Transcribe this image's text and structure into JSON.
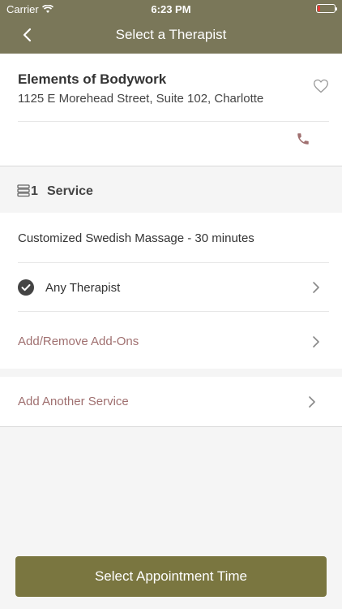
{
  "status_bar": {
    "carrier": "Carrier",
    "time": "6:23 PM",
    "battery_color": "#e53935"
  },
  "nav": {
    "title": "Select a Therapist",
    "back_icon": "chevron-left-icon",
    "bar_color": "#7a7759"
  },
  "location": {
    "name": "Elements of Bodywork",
    "address": "1125 E Morehead Street, Suite 102, Charlotte",
    "favorite_icon": "heart-outline-icon",
    "phone_icon": "phone-icon"
  },
  "services": {
    "icon": "stack-icon",
    "count": "1",
    "label": "Service",
    "items": [
      {
        "name": "Customized Swedish Massage - 30 minutes",
        "therapist": "Any Therapist",
        "addons_label": "Add/Remove Add-Ons"
      }
    ],
    "add_another_label": "Add Another Service",
    "accent_color": "#a07070"
  },
  "cta": {
    "label": "Select Appointment Time",
    "color": "#7a7640"
  }
}
